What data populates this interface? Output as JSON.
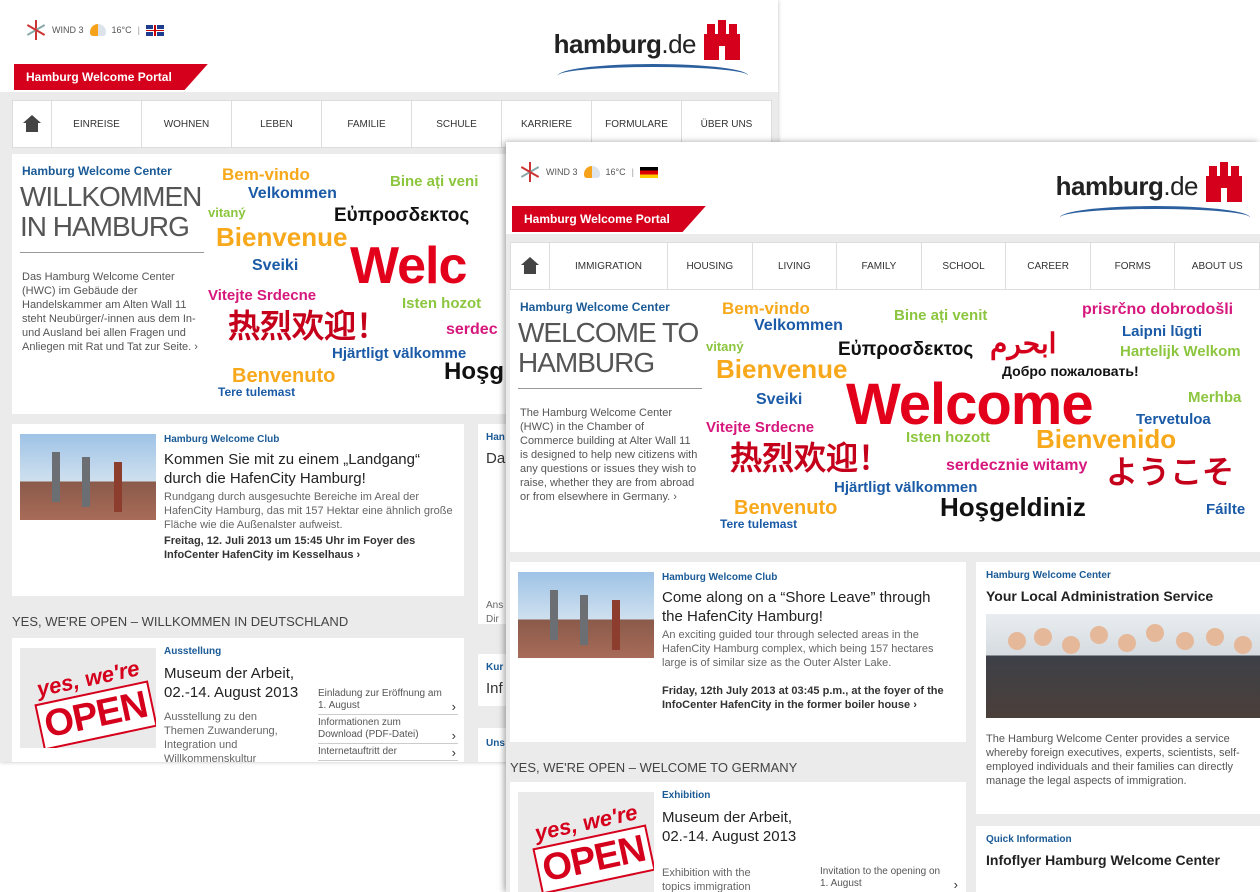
{
  "back": {
    "weather": {
      "wind": "WIND 3",
      "temp": "16°C",
      "sep": "|"
    },
    "logo": {
      "bold": "hamburg",
      "rest": ".de"
    },
    "portal": "Hamburg Welcome Portal",
    "nav": [
      "EINREISE",
      "WOHNEN",
      "LEBEN",
      "FAMILIE",
      "SCHULE",
      "KARRIERE",
      "FORMULARE",
      "ÜBER UNS"
    ],
    "hero": {
      "label": "Hamburg Welcome Center",
      "title_line1": "WILLKOMMEN",
      "title_line2": "IN HAMBURG",
      "desc": "Das Hamburg Welcome Center (HWC) im Gebäude der Handelskammer am Alten Wall 11 steht Neubürger/-innen aus dem In- und Ausland bei allen Fragen und Anliegen mit Rat und Tat zur Seite. ›"
    },
    "club": {
      "category": "Hamburg Welcome Club",
      "title": "Kommen Sie mit zu einem „Landgang“ durch die HafenCity Hamburg!",
      "body": "Rundgang durch ausgesuchte Bereiche im Areal der HafenCity Hamburg, das mit 157 Hektar eine ähnlich große Fläche wie die Außenalster aufweist.",
      "date": "Freitag, 12. Juli 2013 um 15:45 Uhr im Foyer des InfoCenter HafenCity im Kesselhaus ›"
    },
    "section_title": "YES, WE'RE OPEN – WILLKOMMEN IN DEUTSCHLAND",
    "expo": {
      "category": "Ausstellung",
      "title": "Museum der Arbeit, 02.-14. August 2013",
      "sub": "Ausstellung zu den Themen Zuwanderung, Integration und Willkommenskultur",
      "links": [
        "Einladung zur Eröffnung am 1. August",
        "Informationen zum Download (PDF-Datei)",
        "Internetauftritt der"
      ]
    },
    "side_clips": [
      {
        "cat": "Han",
        "txt": "Da"
      },
      {
        "cat": "",
        "txt": "Ans"
      },
      {
        "cat": "",
        "txt": "Dir"
      },
      {
        "cat": "Kur",
        "txt": "Inf"
      },
      {
        "cat": "Uns",
        "txt": ""
      }
    ]
  },
  "front": {
    "weather": {
      "wind": "WIND 3",
      "temp": "16°C",
      "sep": "|"
    },
    "logo": {
      "bold": "hamburg",
      "rest": ".de"
    },
    "portal": "Hamburg Welcome Portal",
    "nav": [
      "IMMIGRATION",
      "HOUSING",
      "LIVING",
      "FAMILY",
      "SCHOOL",
      "CAREER",
      "FORMS",
      "ABOUT US"
    ],
    "hero": {
      "label": "Hamburg Welcome Center",
      "title_line1": "WELCOME TO",
      "title_line2": "HAMBURG",
      "desc": "The Hamburg Welcome Center (HWC) in the Chamber of Commerce building at Alter Wall 11 is designed to help new citizens with any questions or issues they wish to raise, whether they are from abroad or from elsewhere in Germany. ›"
    },
    "club": {
      "category": "Hamburg Welcome Club",
      "title": "Come along on a “Shore Leave” through the HafenCity Hamburg!",
      "body": "An exciting guided tour through selected areas in the HafenCity Hamburg complex, which being 157 hectares large is of similar size as the Outer Alster Lake.",
      "date": "Friday, 12th July 2013 at 03:45 p.m., at the foyer of the InfoCenter HafenCity in the former boiler house ›"
    },
    "section_title": "YES, WE'RE OPEN – WELCOME TO GERMANY",
    "expo": {
      "category": "Exhibition",
      "title": "Museum der Arbeit, 02.-14. August 2013",
      "sub": "Exhibition with the topics immigration",
      "links": [
        "Invitation to the opening on 1. August"
      ]
    },
    "service": {
      "category": "Hamburg Welcome Center",
      "title": "Your Local Administration Service",
      "body": "The Hamburg Welcome Center provides a service whereby foreign executives, experts, scientists, self-employed individuals and their families can directly manage the legal aspects of immigration."
    },
    "quick": {
      "category": "Quick Information",
      "title": "Infoflyer Hamburg Welcome Center"
    }
  },
  "collage_back": [
    "Bem-vindo",
    "Velkommen",
    "Bine ați veni",
    "vitaný",
    "Εὐπροσδεκτος",
    "Bienvenue",
    "Sveiki",
    "Welc",
    "Vitejte Srdecne",
    "Isten hozot",
    "热烈欢迎！",
    "serdec",
    "Hjärtligt välkomme",
    "Benvenuto",
    "Tere tulemast",
    "Hoşg"
  ],
  "collage_front": [
    "Bem-vindo",
    "Bine ați venit",
    "prisrčno dobrodošli",
    "Velkommen",
    "Laipni lūgti",
    "vitaný",
    "Εὐπροσδεκτος",
    "ابحرم",
    "Hartelijk Welkom",
    "Bienvenue",
    "Добро пожаловать!",
    "Sveiki",
    "Welcome",
    "Merhba",
    "Tervetuloa",
    "Vitejte Srdecne",
    "Isten hozott",
    "Bienvenido",
    "热烈欢迎！",
    "serdecznie witamy",
    "ようこそ",
    "Hjärtligt välkommen",
    "Benvenuto",
    "Hoşgeldiniz",
    "Tere tulemast",
    "Fáilte"
  ]
}
